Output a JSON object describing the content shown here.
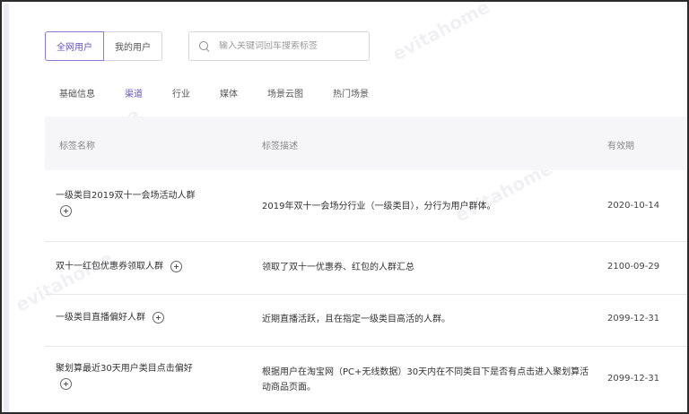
{
  "user_toggle": {
    "all_users": "全网用户",
    "my_users": "我的用户"
  },
  "search": {
    "placeholder": "输入关键词回车搜索标签"
  },
  "tabs": [
    "基础信息",
    "渠道",
    "行业",
    "媒体",
    "场景云图",
    "热门场景"
  ],
  "active_tab": "渠道",
  "table": {
    "headers": {
      "name": "标签名称",
      "description": "标签描述",
      "expiry": "有效期"
    },
    "rows": [
      {
        "name": "一级类目2019双十一会场活动人群",
        "description": "2019年双十一会场分行业（一级类目），分行为用户群体。",
        "expiry": "2020-10-14"
      },
      {
        "name": "双十一红包优惠券领取人群",
        "description": "领取了双十一优惠券、红包的人群汇总",
        "expiry": "2100-09-29"
      },
      {
        "name": "一级类目直播偏好人群",
        "description": "近期直播活跃，且在指定一级类目高活的人群。",
        "expiry": "2099-12-31"
      },
      {
        "name": "聚划算最近30天用户类目点击偏好",
        "description": "根据用户在淘宝网（PC+无线数据）30天内在不同类目下是否有点击进入聚划算活动商品页面。",
        "expiry": "2099-12-31"
      }
    ]
  },
  "colors": {
    "accent": "#6a52c6",
    "border": "#d6d6dc",
    "header_bg": "#f6f6f8"
  }
}
